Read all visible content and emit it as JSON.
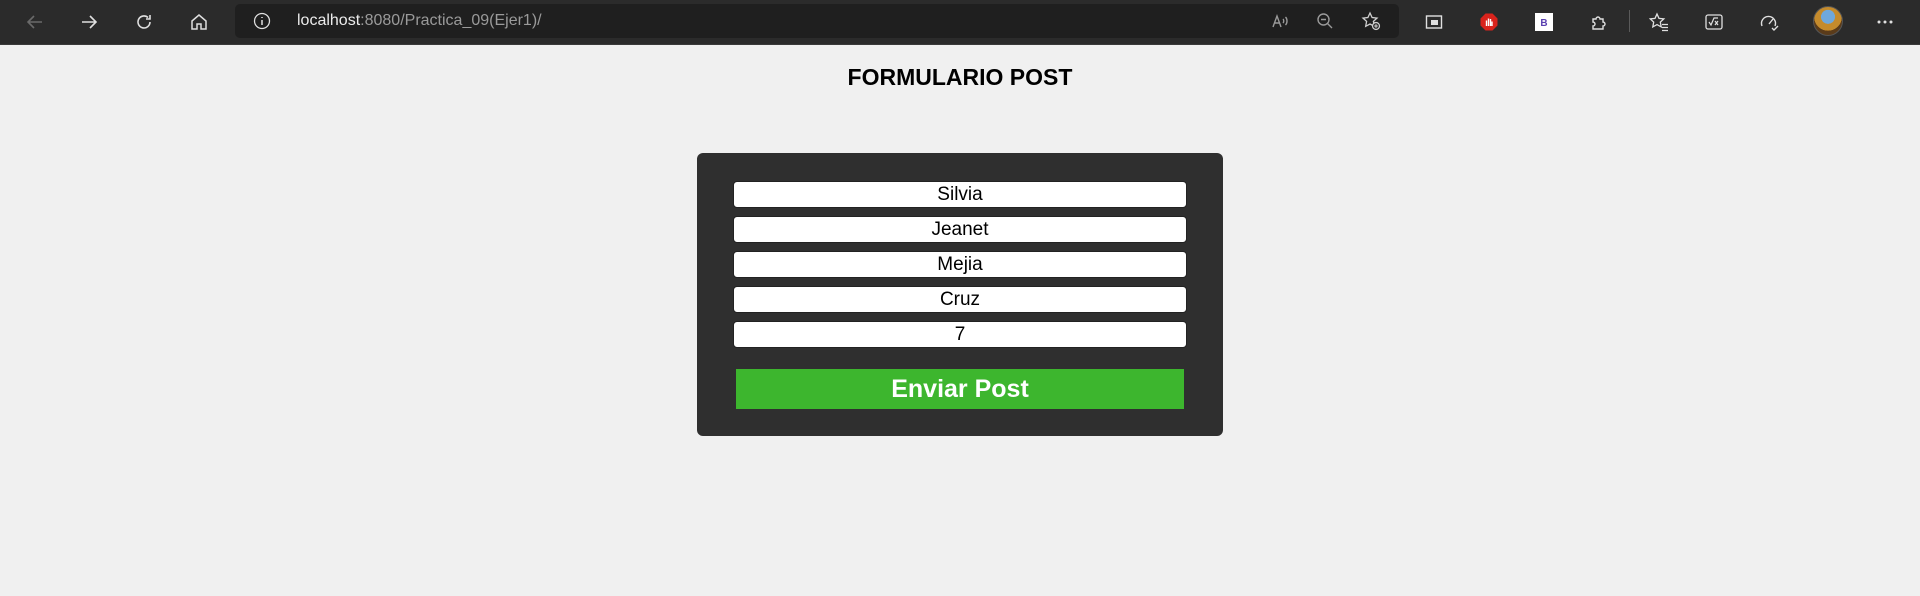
{
  "browser": {
    "url_host": "localhost",
    "url_path": ":8080/Practica_09(Ejer1)/"
  },
  "page": {
    "title": "FORMULARIO POST"
  },
  "form": {
    "fields": [
      {
        "value": "Silvia"
      },
      {
        "value": "Jeanet"
      },
      {
        "value": "Mejia"
      },
      {
        "value": "Cruz"
      },
      {
        "value": "7"
      }
    ],
    "submit_label": "Enviar Post"
  },
  "colors": {
    "submit_button": "#3db62e",
    "form_background": "#2f2f2f",
    "page_background": "#f0f0f0"
  },
  "icons": [
    "back-icon",
    "forward-icon",
    "refresh-icon",
    "home-icon",
    "info-icon",
    "read-aloud-icon",
    "zoom-out-icon",
    "add-favorite-icon",
    "sidebar-icon",
    "adblock-icon",
    "bootstrap-extension-icon",
    "extensions-icon",
    "favorites-icon",
    "math-solver-icon",
    "performance-icon",
    "settings-more-icon"
  ]
}
